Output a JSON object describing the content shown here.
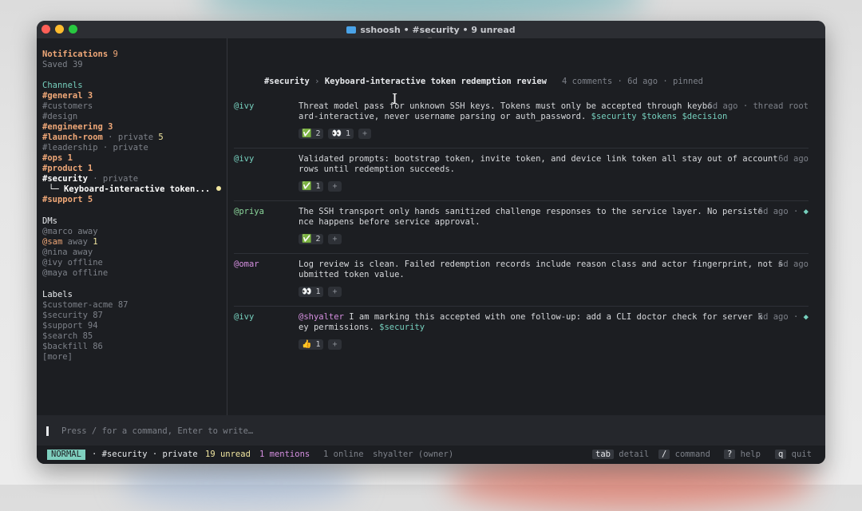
{
  "window": {
    "title": "sshoosh • #security • 9 unread",
    "grip": "…"
  },
  "sidebar": {
    "notifications": {
      "label": "Notifications",
      "count": "9"
    },
    "saved": {
      "label": "Saved",
      "count": "39"
    },
    "channels_heading": "Channels",
    "channels": [
      {
        "name": "#general",
        "suffix": " 3"
      },
      {
        "name": "#customers",
        "suffix": ""
      },
      {
        "name": "#design",
        "suffix": ""
      },
      {
        "name": "#engineering",
        "suffix": " 3"
      },
      {
        "name": "#launch-room",
        "private": " · private",
        "suffix": " 5"
      },
      {
        "name": "#leadership",
        "private": " · private",
        "suffix": ""
      },
      {
        "name": "#ops",
        "suffix": " 1"
      },
      {
        "name": "#product",
        "suffix": " 1"
      },
      {
        "name": "#security",
        "private": " · private",
        "suffix": ""
      },
      {
        "name": "#support",
        "suffix": " 5"
      }
    ],
    "thread_item": "└─ Keyboard-interactive token...",
    "dms_heading": "DMs",
    "dms": [
      {
        "name": "@marco",
        "status": " away",
        "count": ""
      },
      {
        "name": "@sam",
        "status": " away",
        "count": " 1"
      },
      {
        "name": "@nina",
        "status": " away",
        "count": ""
      },
      {
        "name": "@ivy",
        "status": " offline",
        "count": ""
      },
      {
        "name": "@maya",
        "status": " offline",
        "count": ""
      }
    ],
    "labels_heading": "Labels",
    "labels": [
      "$customer-acme 87",
      "$security 87",
      "$support 94",
      "$search 85",
      "$backfill 86",
      "[more]"
    ]
  },
  "thread": {
    "channel": "#security",
    "arrow": "›",
    "title": "Keyboard-interactive token redemption review",
    "meta": "4 comments · 6d ago · pinned"
  },
  "messages": [
    {
      "author": "@ivy",
      "line1": "Threat model pass for unknown SSH keys. Tokens must only be accepted through keybo",
      "line2a": "ard-interactive, never username parsing or auth_password. ",
      "line2_tags": "$security $tokens $decision",
      "meta": "6d ago · thread root",
      "reactions": [
        {
          "emoji": "✅",
          "count": "2"
        },
        {
          "emoji": "👀",
          "count": "1"
        }
      ]
    },
    {
      "author": "@ivy",
      "line1": "Validated prompts: bootstrap token, invite token, and device link token all stay out of account",
      "line2a": "rows until redemption succeeds.",
      "meta": "6d ago",
      "reactions": [
        {
          "emoji": "✅",
          "count": "1"
        }
      ]
    },
    {
      "author": "@priya",
      "line1": "The SSH transport only hands sanitized challenge responses to the service layer. No persiste",
      "line2a": "nce happens before service approval.",
      "meta": "6d ago · ",
      "meta_mark": "◆",
      "reactions": [
        {
          "emoji": "✅",
          "count": "2"
        }
      ]
    },
    {
      "author": "@omar",
      "line1": "Log review is clean. Failed redemption records include reason class and actor fingerprint, not s",
      "line2a": "ubmitted token value.",
      "meta": "6d ago",
      "reactions": [
        {
          "emoji": "👀",
          "count": "1"
        }
      ]
    },
    {
      "author": "@ivy",
      "mention": "@shyalter",
      "line1": " I am marking this accepted with one follow-up: add a CLI doctor check for server k",
      "line2a": "ey permissions. ",
      "line2_tags": "$security",
      "meta": "6d ago · ",
      "meta_mark": "◆",
      "reactions": [
        {
          "emoji": "👍",
          "count": "1"
        }
      ]
    }
  ],
  "add_reaction": "+",
  "input": {
    "placeholder": "Press / for a command, Enter to write…"
  },
  "status": {
    "mode": "NORMAL",
    "channel": "· #security · private",
    "unread": "19 unread",
    "mentions": "1 mentions",
    "online": "1 online",
    "user": "shyalter (owner)",
    "hints": [
      {
        "key": "tab",
        "label": "detail"
      },
      {
        "key": "/",
        "label": "command"
      },
      {
        "key": "?",
        "label": "help"
      },
      {
        "key": "q",
        "label": "quit"
      }
    ]
  }
}
